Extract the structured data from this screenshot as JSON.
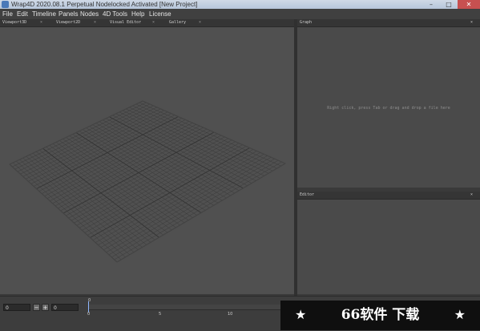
{
  "window": {
    "title": "Wrap4D 2020.08.1  Perpetual Nodelocked Activated  [New Project]"
  },
  "menu": [
    "File",
    "Edit",
    "Timeline",
    "Panels",
    "Nodes",
    "4D Tools",
    "Help",
    "License"
  ],
  "tabs": {
    "viewport3d": "Viewport3D",
    "viewport2d": "Viewport2D",
    "visual_editor": "Visual Editor",
    "gallery": "Gallery",
    "graph": "Graph",
    "editor": "Editor",
    "close_glyph": "×"
  },
  "graph": {
    "hint": "Right click, press Tab or drag and drop a file here"
  },
  "timeline": {
    "start_value": "0",
    "end_value": "0",
    "minus_label": "−",
    "plus_label": "+",
    "current_frame": "0",
    "ticks": [
      "0",
      "5",
      "10"
    ]
  },
  "watermark": {
    "star_left": "★",
    "star_right": "★",
    "text": "66软件 下载"
  },
  "colors": {
    "viewport_bg": "#505050",
    "grid_line": "#3a3a3a",
    "panel_bg": "#4a4a4a",
    "playhead": "#8fb7ff"
  }
}
